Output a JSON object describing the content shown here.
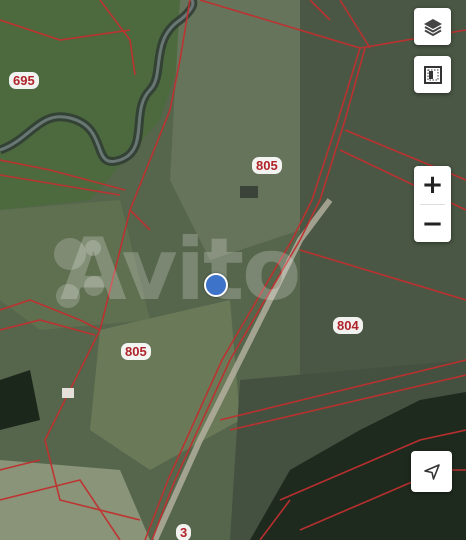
{
  "map": {
    "type": "satellite cadastral map",
    "boundary_color": "#c0302f",
    "parcel_labels": [
      {
        "text": "695"
      },
      {
        "text": "805"
      },
      {
        "text": "805"
      },
      {
        "text": "804"
      },
      {
        "text": "3"
      }
    ],
    "watermark": "Avito",
    "location_marker": "current-location"
  },
  "controls": {
    "layers_icon": "layers-icon",
    "fullscreen_icon": "map-frame-icon",
    "zoom_in": "+",
    "zoom_out": "−",
    "locate_icon": "locate-arrow-icon"
  }
}
